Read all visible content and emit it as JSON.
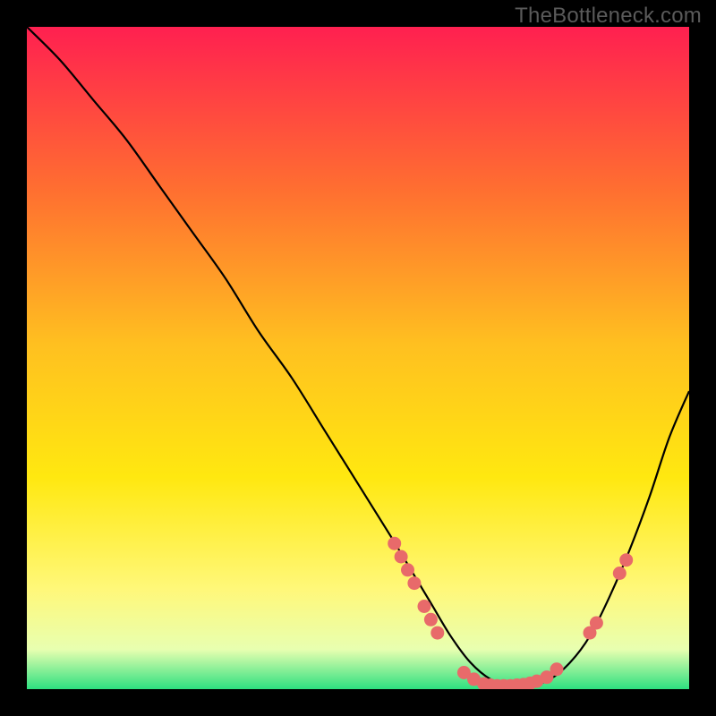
{
  "watermark": "TheBottleneck.com",
  "chart_data": {
    "type": "line",
    "title": "",
    "xlabel": "",
    "ylabel": "",
    "xlim": [
      0,
      100
    ],
    "ylim": [
      0,
      100
    ],
    "gradient": {
      "top": "#ff2050",
      "mid": "#ffe000",
      "bottom": "#2ee080"
    },
    "series": [
      {
        "name": "bottleneck-curve",
        "x": [
          0,
          5,
          10,
          15,
          20,
          25,
          30,
          35,
          40,
          45,
          50,
          55,
          58,
          61,
          64,
          67,
          70,
          73,
          76,
          79,
          82,
          85,
          88,
          91,
          94,
          97,
          100
        ],
        "y": [
          100,
          95,
          89,
          83,
          76,
          69,
          62,
          54,
          47,
          39,
          31,
          23,
          18,
          13,
          8,
          4,
          1.5,
          0.5,
          0.5,
          1.5,
          4,
          8,
          14,
          21,
          29,
          38,
          45
        ]
      }
    ],
    "scatter_points": {
      "name": "data-markers",
      "color": "#e86a6a",
      "points": [
        {
          "x": 55.5,
          "y": 22
        },
        {
          "x": 56.5,
          "y": 20
        },
        {
          "x": 57.5,
          "y": 18
        },
        {
          "x": 58.5,
          "y": 16
        },
        {
          "x": 60.0,
          "y": 12.5
        },
        {
          "x": 61.0,
          "y": 10.5
        },
        {
          "x": 62.0,
          "y": 8.5
        },
        {
          "x": 66.0,
          "y": 2.5
        },
        {
          "x": 67.5,
          "y": 1.5
        },
        {
          "x": 69.0,
          "y": 0.8
        },
        {
          "x": 70.0,
          "y": 0.6
        },
        {
          "x": 71.0,
          "y": 0.5
        },
        {
          "x": 72.0,
          "y": 0.5
        },
        {
          "x": 73.0,
          "y": 0.5
        },
        {
          "x": 74.0,
          "y": 0.6
        },
        {
          "x": 75.0,
          "y": 0.7
        },
        {
          "x": 76.0,
          "y": 0.9
        },
        {
          "x": 77.0,
          "y": 1.2
        },
        {
          "x": 78.5,
          "y": 1.8
        },
        {
          "x": 80.0,
          "y": 3.0
        },
        {
          "x": 85.0,
          "y": 8.5
        },
        {
          "x": 86.0,
          "y": 10.0
        },
        {
          "x": 89.5,
          "y": 17.5
        },
        {
          "x": 90.5,
          "y": 19.5
        }
      ]
    }
  }
}
